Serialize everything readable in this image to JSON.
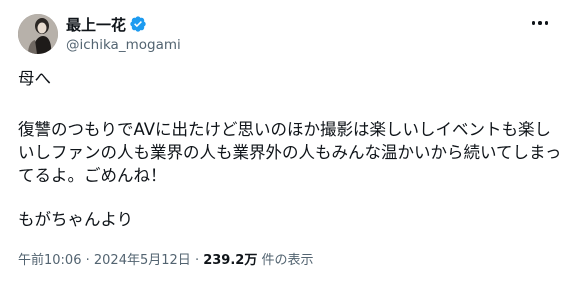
{
  "author": {
    "display_name": "最上一花",
    "handle": "@ichika_mogami",
    "verified": true
  },
  "tweet": {
    "greeting": "母へ",
    "body": "復讐のつもりでAVに出たけど思いのほか撮影は楽しいしイベントも楽しいしファンの人も業界の人も業界外の人もみんな温かいから続いてしまってるよ。ごめんね！",
    "signature": "もがちゃんより"
  },
  "meta": {
    "time": "午前10:06",
    "separator": "·",
    "date": "2024年5月12日",
    "views_count": "239.2万",
    "views_label": "件の表示"
  },
  "colors": {
    "primary_text": "#0f1419",
    "secondary_text": "#536471",
    "verified_badge": "#1d9bf0"
  },
  "icons": {
    "more": "more-horizontal-icon",
    "verified": "verified-badge-icon"
  }
}
